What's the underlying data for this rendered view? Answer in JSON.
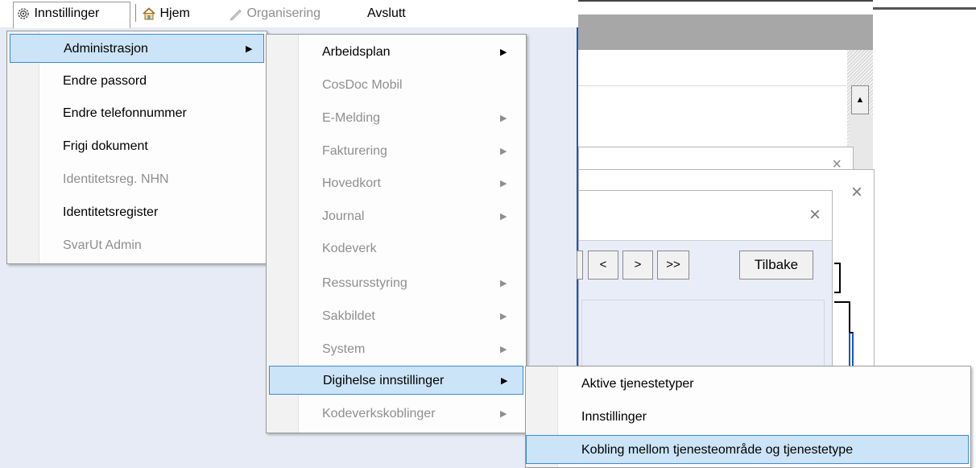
{
  "menubar": {
    "settings": "Innstillinger",
    "home": "Hjem",
    "organise": "Organisering",
    "exit": "Avslutt"
  },
  "settings_menu": [
    {
      "label": "Administrasjon",
      "has_submenu": true,
      "selected": true,
      "enabled": true
    },
    {
      "label": "Endre passord",
      "enabled": true
    },
    {
      "label": "Endre telefonnummer",
      "enabled": true
    },
    {
      "label": "Frigi dokument",
      "enabled": true
    },
    {
      "label": "Identitetsreg. NHN",
      "enabled": false
    },
    {
      "label": "Identitetsregister",
      "enabled": true
    },
    {
      "label": "SvarUt Admin",
      "enabled": false
    }
  ],
  "admin_menu": [
    {
      "label": "Arbeidsplan",
      "has_submenu": true,
      "enabled": true
    },
    {
      "label": "CosDoc Mobil",
      "enabled": false
    },
    {
      "label": "E-Melding",
      "has_submenu": true,
      "enabled": false
    },
    {
      "label": "Fakturering",
      "has_submenu": true,
      "enabled": false
    },
    {
      "label": "Hovedkort",
      "has_submenu": true,
      "enabled": false
    },
    {
      "label": "Journal",
      "has_submenu": true,
      "enabled": false
    },
    {
      "label": "Kodeverk",
      "enabled": false
    },
    {
      "label": "Ressursstyring",
      "has_submenu": true,
      "enabled": false
    },
    {
      "label": "Sakbildet",
      "has_submenu": true,
      "enabled": false
    },
    {
      "label": "System",
      "has_submenu": true,
      "enabled": false
    },
    {
      "label": "Digihelse innstillinger",
      "has_submenu": true,
      "selected": true,
      "enabled": true
    },
    {
      "label": "Kodeverkskoblinger",
      "has_submenu": true,
      "enabled": false
    }
  ],
  "digihelse_menu": [
    {
      "label": "Aktive tjenestetyper",
      "enabled": true
    },
    {
      "label": "Innstillinger",
      "enabled": true
    },
    {
      "label": "Kobling mellom tjenesteområde og tjenestetype",
      "enabled": true,
      "selected": true
    }
  ],
  "dialog": {
    "nav_first": "<",
    "nav_next": ">",
    "nav_last": ">>",
    "back": "Tilbake",
    "close": "×"
  },
  "icons": {
    "settings": "gear-icon",
    "home": "house-icon",
    "organise": "pencil-icon",
    "submenu": "triangle-right-icon",
    "scroll": "triangle-up-icon"
  },
  "colors": {
    "selection_bg": "#cce4f7",
    "selection_border": "#3d8ad8",
    "window_border": "#1a56c8",
    "disabled_text": "#8f8f8f"
  }
}
